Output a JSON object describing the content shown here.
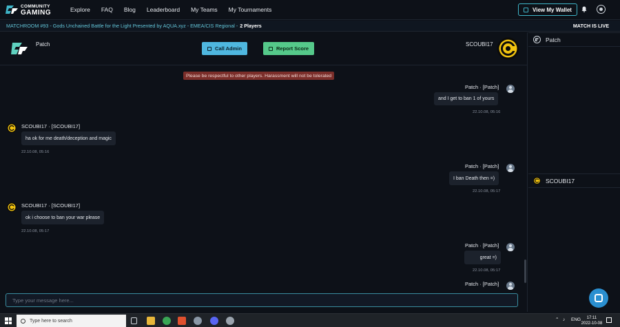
{
  "nav": {
    "logo_line1": "COMMUNITY",
    "logo_line2": "GAMING",
    "items": [
      "Explore",
      "FAQ",
      "Blog",
      "Leaderboard",
      "My Teams",
      "My Tournaments"
    ],
    "wallet_label": "View My Wallet"
  },
  "match": {
    "title": "MATCHROOM #93 - Gods Unchained Battle for the Light Presented by AQUA.xyz - EMEA/CIS Regional -",
    "players": "2 Players",
    "status": "MATCH IS LIVE"
  },
  "chat": {
    "left_player": "Patch",
    "right_player": "SCOUBI17",
    "call_admin": "Call Admin",
    "report_score": "Report Score",
    "notice": "Please be respectful to other players. Harassment will not be tolerated",
    "messages": [
      {
        "author": "Patch · [Patch]",
        "text": "and I get to ban 1 of yours",
        "time": "22.10.08, 05:16"
      },
      {
        "author": "SCOUBI17 · [SCOUBI17]",
        "text": "ha ok for me death/deception and magic",
        "time": "22.10.08, 05:16"
      },
      {
        "author": "Patch · [Patch]",
        "text": "I ban Death then =)",
        "time": "22.10.08, 05:17"
      },
      {
        "author": "SCOUBI17 · [SCOUBI17]",
        "text": "ok i choose to ban your war please",
        "time": "22.10.08, 05:17"
      },
      {
        "author": "Patch · [Patch]",
        "text": "great =)",
        "time": "22.10.08, 05:17"
      },
      {
        "author": "Patch · [Patch]"
      }
    ],
    "input_placeholder": "Type your message here..."
  },
  "sidebar": {
    "players": [
      "Patch",
      "SCOUBI17"
    ]
  },
  "taskbar": {
    "search_placeholder": "Type here to search",
    "language": "ENG",
    "time": "17:11",
    "date": "2022-10-08"
  },
  "colors": {
    "background": "#0d1118",
    "accent": "#3fb6c9",
    "call_admin": "#4fb7df",
    "report_score": "#55c98a",
    "notice_bg": "#7b2e2a",
    "coin_yellow": "#f2c40f"
  }
}
